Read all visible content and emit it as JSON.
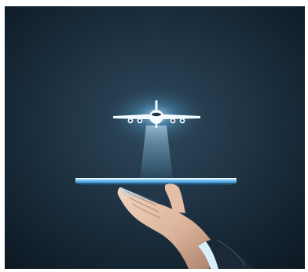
{
  "scene": {
    "subject": "airplane-icon",
    "support": "tablet",
    "hand": "hand",
    "sleeve": "suit-sleeve",
    "colors": {
      "background_center": "#2f4a5e",
      "background_edge": "#0c1822",
      "glow": "#bfe6ff",
      "airplane": "#f4fbff",
      "tablet": "#6fc2f2",
      "tablet_edge": "#d9f1ff",
      "skin": "#e9c8b1",
      "skin_shadow": "#a9806a",
      "sleeve": "#1b2836",
      "cuff": "#d9eefb"
    }
  }
}
